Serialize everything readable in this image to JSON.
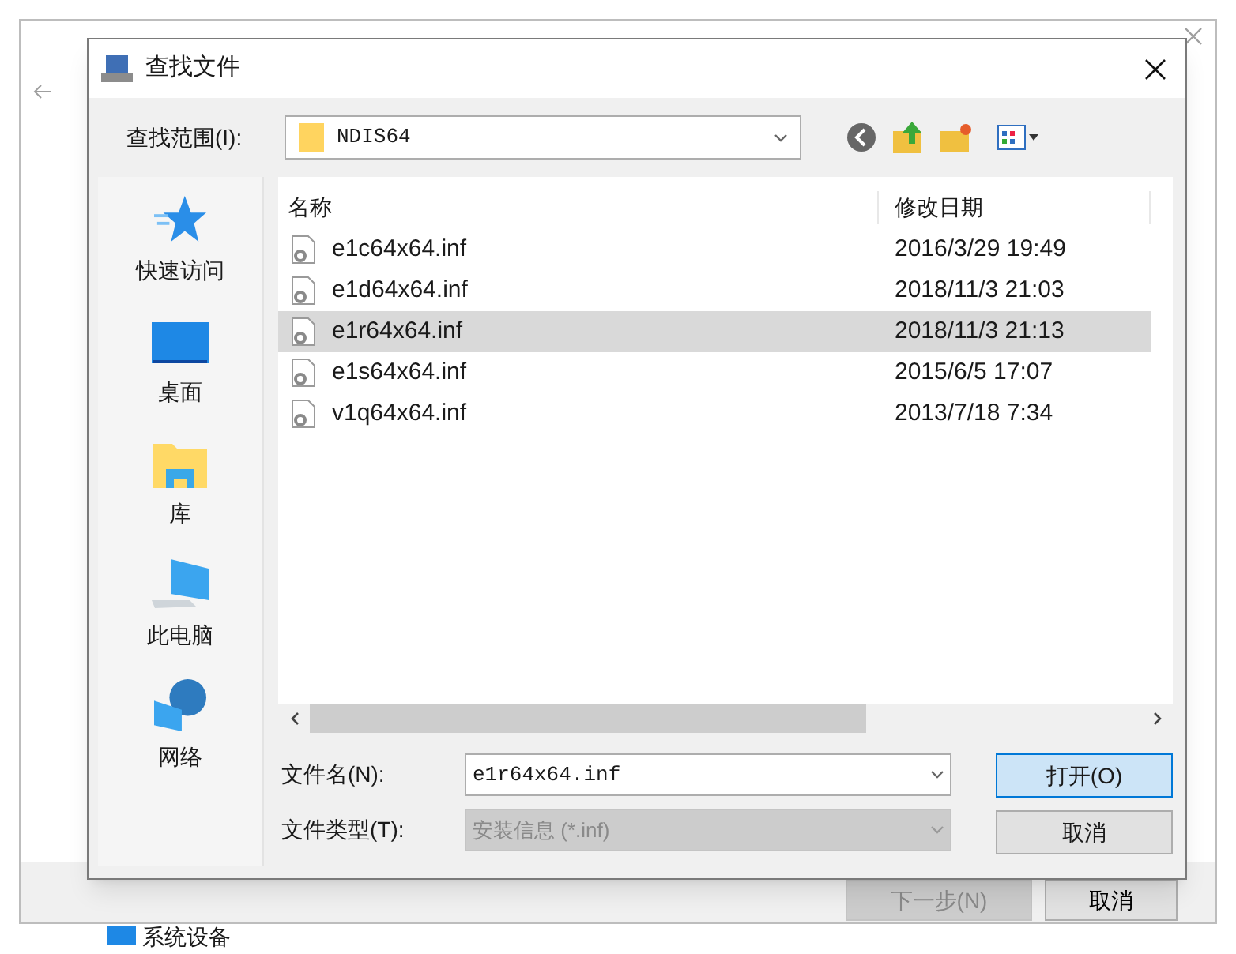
{
  "background_window": {
    "footer_buttons": [
      {
        "label": "下一步(N)",
        "disabled": true
      },
      {
        "label": "取消",
        "disabled": false
      }
    ],
    "list_item": "系统设备"
  },
  "dialog": {
    "title": "查找文件",
    "look_in": {
      "label": "查找范围(I):",
      "value": "NDIS64"
    },
    "places": [
      {
        "kind": "star",
        "label": "快速访问"
      },
      {
        "kind": "desktop",
        "label": "桌面"
      },
      {
        "kind": "library",
        "label": "库"
      },
      {
        "kind": "computer",
        "label": "此电脑"
      },
      {
        "kind": "network",
        "label": "网络"
      }
    ],
    "table": {
      "columns": [
        "名称",
        "修改日期"
      ],
      "rows": [
        {
          "name": "e1c64x64.inf",
          "modified": "2016/3/29 19:49",
          "selected": false
        },
        {
          "name": "e1d64x64.inf",
          "modified": "2018/11/3 21:03",
          "selected": false
        },
        {
          "name": "e1r64x64.inf",
          "modified": "2018/11/3 21:13",
          "selected": true
        },
        {
          "name": "e1s64x64.inf",
          "modified": "2015/6/5 17:07",
          "selected": false
        },
        {
          "name": "v1q64x64.inf",
          "modified": "2013/7/18 7:34",
          "selected": false
        }
      ]
    },
    "file_name": {
      "label": "文件名(N):",
      "value": "e1r64x64.inf"
    },
    "file_type": {
      "label": "文件类型(T):",
      "value": "安装信息 (*.inf)",
      "disabled": true
    },
    "buttons": [
      {
        "label": "打开(O)",
        "default": true
      },
      {
        "label": "取消",
        "default": false
      }
    ]
  }
}
